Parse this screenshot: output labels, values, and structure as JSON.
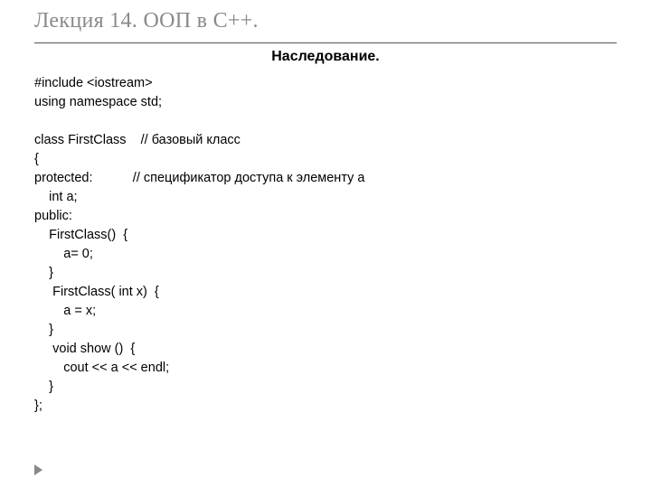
{
  "title": "Лекция 14. ООП в С++.",
  "subtitle": "Наследование.",
  "code_lines": [
    "#include <iostream>",
    "using namespace std;",
    "",
    "class FirstClass    // базовый класс",
    "{",
    "protected:           // спецификатор доступа к элементу a",
    "    int a;",
    "public:",
    "    FirstClass()  {",
    "        a= 0;",
    "    }",
    "     FirstClass( int x)  {",
    "        a = x;",
    "    }",
    "     void show ()  {",
    "        cout << a << endl;",
    "    }",
    "};"
  ]
}
